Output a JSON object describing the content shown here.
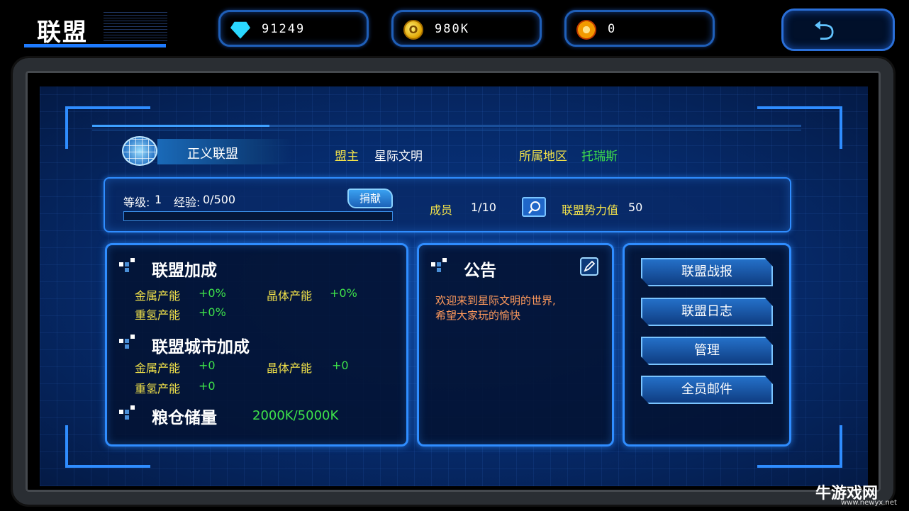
{
  "header": {
    "title": "联盟"
  },
  "resources": {
    "diamonds": "91249",
    "gold": "980K",
    "crystal": "0"
  },
  "alliance": {
    "name": "正义联盟",
    "leader_label": "盟主",
    "leader": "星际文明",
    "region_label": "所属地区",
    "region": "托瑞斯"
  },
  "stats": {
    "level_label": "等级:",
    "level": "1",
    "exp_label": "经验:",
    "exp": "0/500",
    "exp_progress": 0,
    "donate_label": "捐献",
    "members_label": "成员",
    "members": "1/10",
    "power_label": "联盟势力值",
    "power": "50"
  },
  "bonus": {
    "title": "联盟加成",
    "metal_label": "金属产能",
    "metal": "+0%",
    "crystal_label": "晶体产能",
    "crystal": "+0%",
    "gas_label": "重氢产能",
    "gas": "+0%"
  },
  "city_bonus": {
    "title": "联盟城市加成",
    "metal_label": "金属产能",
    "metal": "+0",
    "crystal_label": "晶体产能",
    "crystal": "+0",
    "gas_label": "重氢产能",
    "gas": "+0"
  },
  "granary": {
    "title": "粮仓储量",
    "value": "2000K/5000K"
  },
  "notice": {
    "title": "公告",
    "line1": "欢迎来到星际文明的世界,",
    "line2": "希望大家玩的愉快"
  },
  "actions": [
    "联盟战报",
    "联盟日志",
    "管理",
    "全员邮件"
  ],
  "watermark": {
    "text": "牛游戏网",
    "url": "www.newyx.net"
  },
  "colors": {
    "accent": "#2f8dff",
    "label_yellow": "#f2e24a",
    "value_green": "#3ee24a",
    "notice_orange": "#ff9a5c"
  }
}
